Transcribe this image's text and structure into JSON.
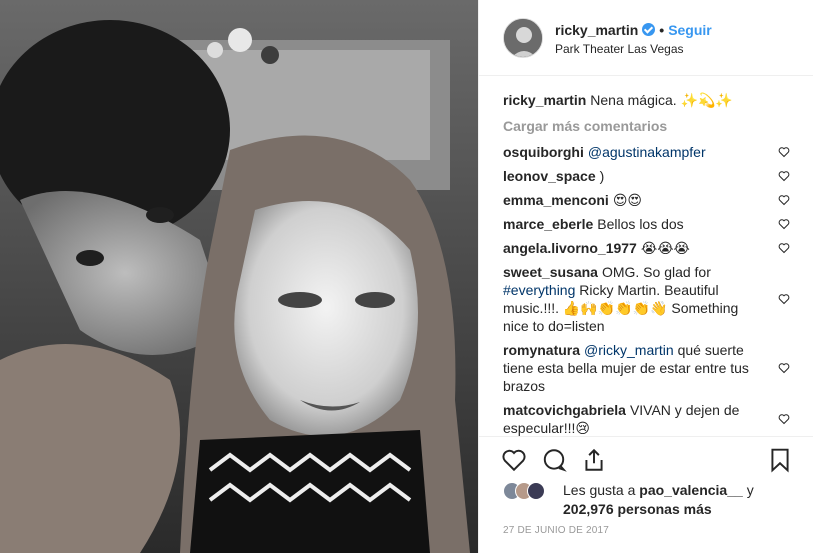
{
  "post": {
    "username": "ricky_martin",
    "follow_label": "Seguir",
    "separator": "•",
    "location": "Park Theater Las Vegas"
  },
  "caption": {
    "username": "ricky_martin",
    "text": "Nena mágica. ✨💫✨"
  },
  "load_more_label": "Cargar más comentarios",
  "comments": [
    {
      "username": "osquiborghi",
      "mention": "@agustinakampfer",
      "text": ""
    },
    {
      "username": "leonov_space",
      "mention": "",
      "text": ")"
    },
    {
      "username": "emma_menconi",
      "mention": "",
      "text": "😍😍"
    },
    {
      "username": "marce_eberle",
      "mention": "",
      "text": "Bellos los dos"
    },
    {
      "username": "angela.livorno_1977",
      "mention": "",
      "text": "😭😭😭"
    },
    {
      "username": "sweet_susana",
      "text_before": "OMG. So glad for",
      "mention": "#everything",
      "text": "Ricky Martin. Beautiful music.!!!. 👍🙌👏👏👏👋 Something nice to do=listen"
    },
    {
      "username": "romynatura",
      "mention": "@ricky_martin",
      "text": "qué suerte tiene esta bella mujer de estar entre tus brazos"
    },
    {
      "username": "matcovichgabriela",
      "mention": "",
      "text": "VIVAN y dejen de especular!!!😢"
    }
  ],
  "likes": {
    "prefix": "Les gusta a",
    "user": "pao_valencia__",
    "conjunction": "y",
    "count": "202,976 personas más"
  },
  "date": "27 DE JUNIO DE 2017",
  "icons": {
    "like": "heart-icon",
    "comment": "comment-icon",
    "share": "share-icon",
    "save": "bookmark-icon"
  },
  "colors": {
    "accent": "#3897f0",
    "text": "#262626",
    "muted": "#999999",
    "mention": "#003569"
  }
}
